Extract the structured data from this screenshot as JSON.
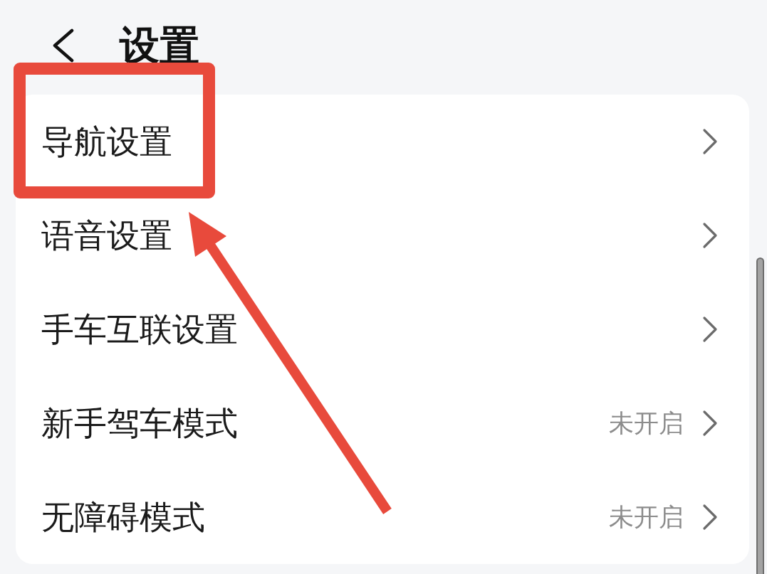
{
  "header": {
    "title": "设置"
  },
  "rows": [
    {
      "label": "导航设置",
      "highlighted": true
    },
    {
      "label": "语音设置",
      "highlighted": false
    },
    {
      "label": "手车互联设置",
      "highlighted": false
    },
    {
      "label": "新手驾车模式",
      "value": "未开启",
      "highlighted": false
    },
    {
      "label": "无障碍模式",
      "value": "未开启",
      "highlighted": false
    }
  ]
}
